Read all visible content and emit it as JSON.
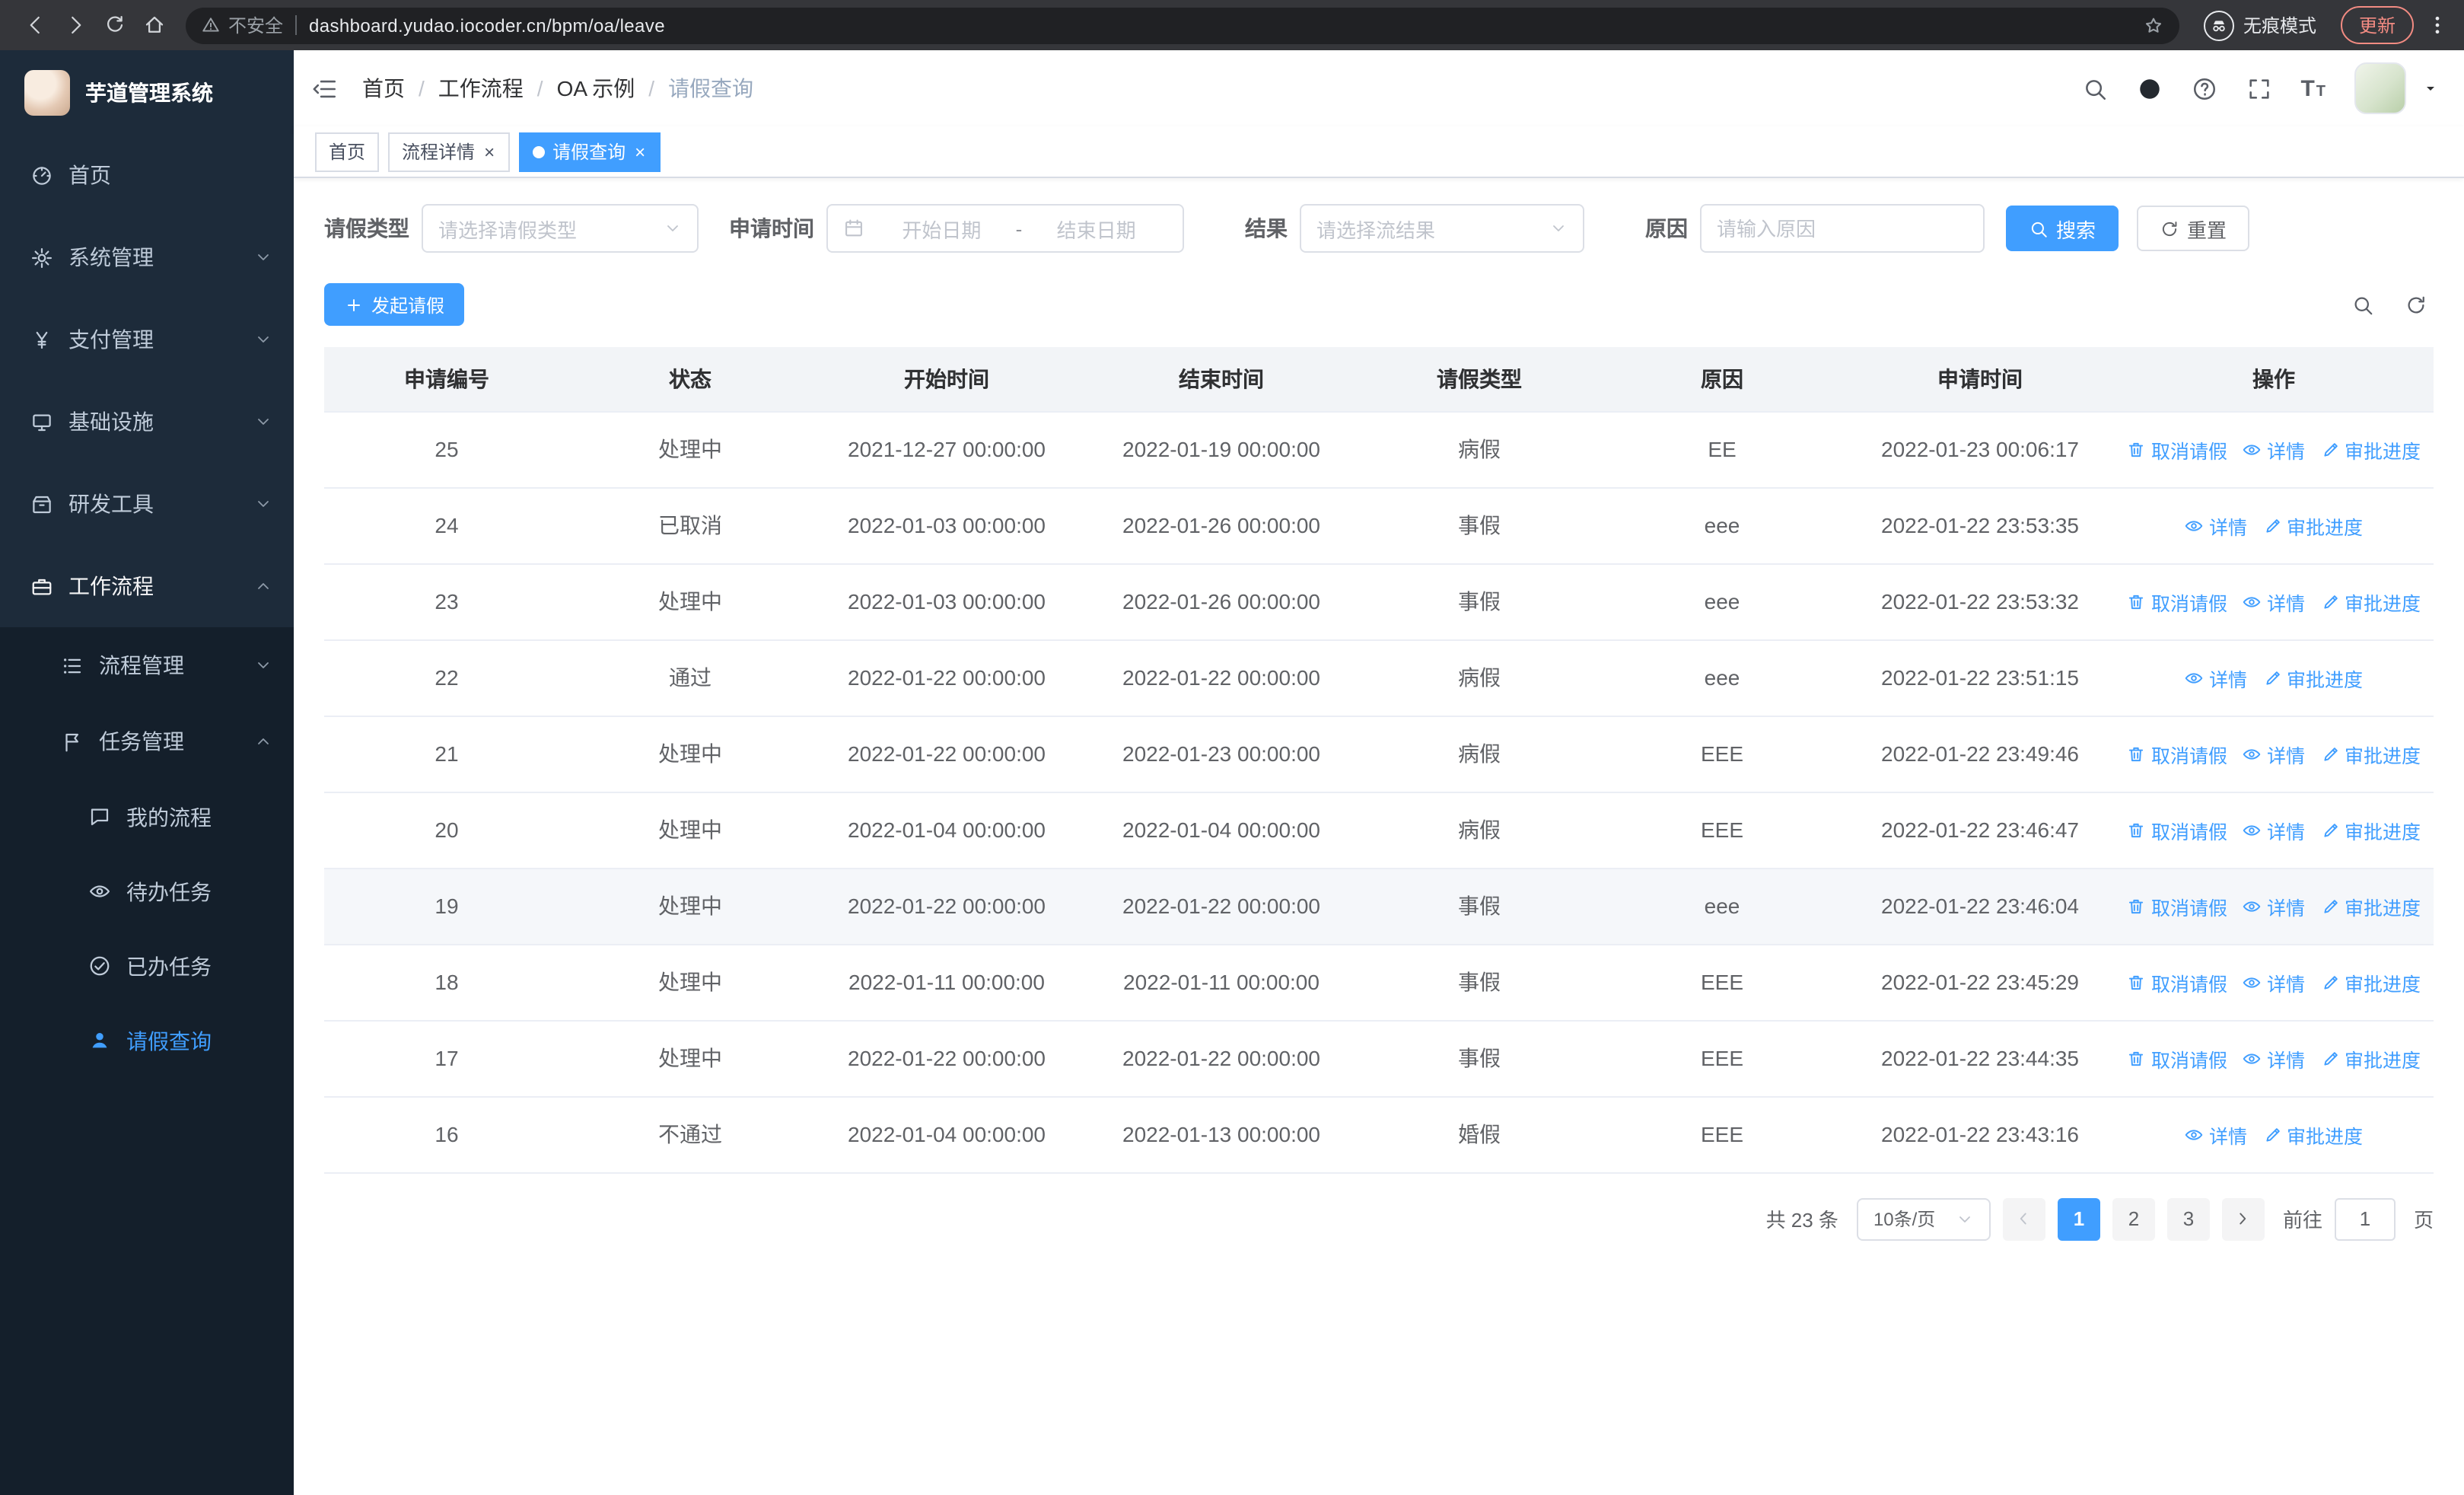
{
  "browser": {
    "security_label": "不安全",
    "url": "dashboard.yudao.iocoder.cn/bpm/oa/leave",
    "incognito_label": "无痕模式",
    "update_label": "更新"
  },
  "sidebar": {
    "logo_title": "芋道管理系统",
    "menu": [
      {
        "key": "home",
        "label": "首页",
        "icon": "dashboard",
        "level": 1
      },
      {
        "key": "system",
        "label": "系统管理",
        "icon": "gear",
        "level": 1,
        "chevron": "down"
      },
      {
        "key": "payment",
        "label": "支付管理",
        "icon": "yen",
        "level": 1,
        "chevron": "down"
      },
      {
        "key": "infra",
        "label": "基础设施",
        "icon": "monitor",
        "level": 1,
        "chevron": "down"
      },
      {
        "key": "devtools",
        "label": "研发工具",
        "icon": "box",
        "level": 1,
        "chevron": "down"
      },
      {
        "key": "workflow",
        "label": "工作流程",
        "icon": "briefcase",
        "level": 1,
        "chevron": "up",
        "parent_active": true
      },
      {
        "key": "process-mgmt",
        "label": "流程管理",
        "icon": "tree",
        "level": 2,
        "chevron": "down"
      },
      {
        "key": "task-mgmt",
        "label": "任务管理",
        "icon": "flag",
        "level": 2,
        "chevron": "up"
      },
      {
        "key": "my-process",
        "label": "我的流程",
        "icon": "chat",
        "level": 3
      },
      {
        "key": "todo-tasks",
        "label": "待办任务",
        "icon": "eye",
        "level": 3
      },
      {
        "key": "done-tasks",
        "label": "已办任务",
        "icon": "check",
        "level": 3
      },
      {
        "key": "leave-query",
        "label": "请假查询",
        "icon": "user",
        "level": 3,
        "active": true
      }
    ]
  },
  "header": {
    "breadcrumb": [
      "首页",
      "工作流程",
      "OA 示例",
      "请假查询"
    ]
  },
  "tabs": [
    {
      "label": "首页",
      "closable": false,
      "active": false
    },
    {
      "label": "流程详情",
      "closable": true,
      "active": false
    },
    {
      "label": "请假查询",
      "closable": true,
      "active": true
    }
  ],
  "filters": {
    "leave_type_label": "请假类型",
    "leave_type_placeholder": "请选择请假类型",
    "apply_time_label": "申请时间",
    "start_date_placeholder": "开始日期",
    "range_separator": "-",
    "end_date_placeholder": "结束日期",
    "result_label": "结果",
    "result_placeholder": "请选择流结果",
    "reason_label": "原因",
    "reason_placeholder": "请输入原因",
    "search_label": "搜索",
    "reset_label": "重置"
  },
  "toolbar": {
    "create_label": "发起请假"
  },
  "table": {
    "columns": [
      "申请编号",
      "状态",
      "开始时间",
      "结束时间",
      "请假类型",
      "原因",
      "申请时间",
      "操作"
    ],
    "action_labels": {
      "cancel": "取消请假",
      "detail": "详情",
      "progress": "审批进度"
    },
    "rows": [
      {
        "id": "25",
        "status": "处理中",
        "start": "2021-12-27 00:00:00",
        "end": "2022-01-19 00:00:00",
        "type": "病假",
        "reason": "EE",
        "applied": "2022-01-23 00:06:17",
        "actions": [
          "cancel",
          "detail",
          "progress"
        ]
      },
      {
        "id": "24",
        "status": "已取消",
        "start": "2022-01-03 00:00:00",
        "end": "2022-01-26 00:00:00",
        "type": "事假",
        "reason": "eee",
        "applied": "2022-01-22 23:53:35",
        "actions": [
          "detail",
          "progress"
        ]
      },
      {
        "id": "23",
        "status": "处理中",
        "start": "2022-01-03 00:00:00",
        "end": "2022-01-26 00:00:00",
        "type": "事假",
        "reason": "eee",
        "applied": "2022-01-22 23:53:32",
        "actions": [
          "cancel",
          "detail",
          "progress"
        ]
      },
      {
        "id": "22",
        "status": "通过",
        "start": "2022-01-22 00:00:00",
        "end": "2022-01-22 00:00:00",
        "type": "病假",
        "reason": "eee",
        "applied": "2022-01-22 23:51:15",
        "actions": [
          "detail",
          "progress"
        ]
      },
      {
        "id": "21",
        "status": "处理中",
        "start": "2022-01-22 00:00:00",
        "end": "2022-01-23 00:00:00",
        "type": "病假",
        "reason": "EEE",
        "applied": "2022-01-22 23:49:46",
        "actions": [
          "cancel",
          "detail",
          "progress"
        ]
      },
      {
        "id": "20",
        "status": "处理中",
        "start": "2022-01-04 00:00:00",
        "end": "2022-01-04 00:00:00",
        "type": "病假",
        "reason": "EEE",
        "applied": "2022-01-22 23:46:47",
        "actions": [
          "cancel",
          "detail",
          "progress"
        ]
      },
      {
        "id": "19",
        "status": "处理中",
        "start": "2022-01-22 00:00:00",
        "end": "2022-01-22 00:00:00",
        "type": "事假",
        "reason": "eee",
        "applied": "2022-01-22 23:46:04",
        "actions": [
          "cancel",
          "detail",
          "progress"
        ],
        "hover": true
      },
      {
        "id": "18",
        "status": "处理中",
        "start": "2022-01-11 00:00:00",
        "end": "2022-01-11 00:00:00",
        "type": "事假",
        "reason": "EEE",
        "applied": "2022-01-22 23:45:29",
        "actions": [
          "cancel",
          "detail",
          "progress"
        ]
      },
      {
        "id": "17",
        "status": "处理中",
        "start": "2022-01-22 00:00:00",
        "end": "2022-01-22 00:00:00",
        "type": "事假",
        "reason": "EEE",
        "applied": "2022-01-22 23:44:35",
        "actions": [
          "cancel",
          "detail",
          "progress"
        ]
      },
      {
        "id": "16",
        "status": "不通过",
        "start": "2022-01-04 00:00:00",
        "end": "2022-01-13 00:00:00",
        "type": "婚假",
        "reason": "EEE",
        "applied": "2022-01-22 23:43:16",
        "actions": [
          "detail",
          "progress"
        ]
      }
    ]
  },
  "pagination": {
    "total_text": "共 23 条",
    "page_size": "10条/页",
    "pages": [
      "1",
      "2",
      "3"
    ],
    "active_page": "1",
    "goto_label": "前往",
    "goto_value": "1",
    "page_label": "页"
  }
}
